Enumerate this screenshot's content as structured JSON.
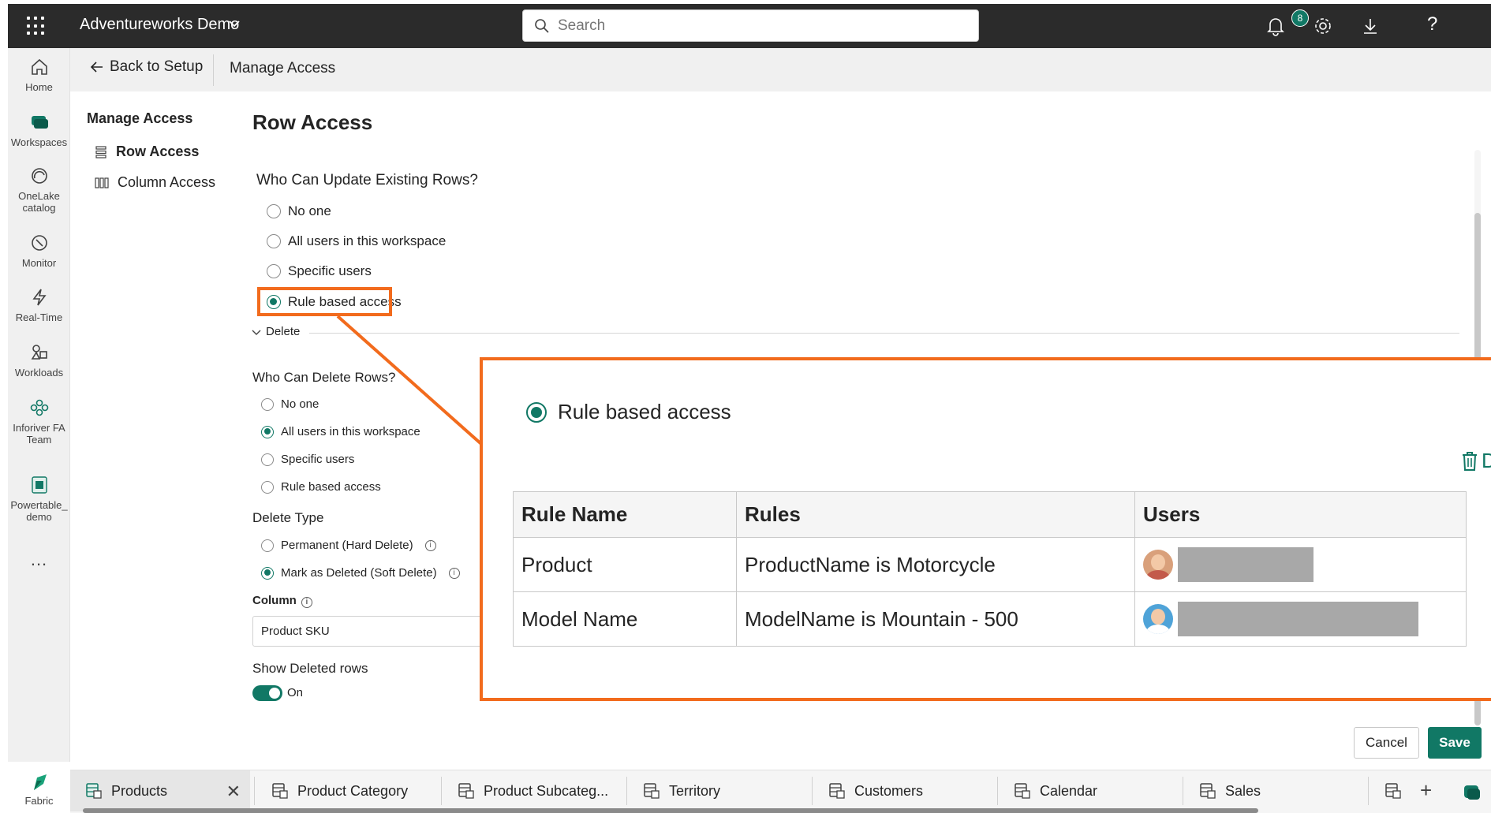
{
  "topbar": {
    "app_name": "Adventureworks Demo",
    "search_placeholder": "Search",
    "notification_count": "8",
    "help_label": "?"
  },
  "rail": {
    "items": [
      {
        "label": "Home",
        "icon": "home-icon"
      },
      {
        "label": "Workspaces",
        "icon": "workspaces-icon"
      },
      {
        "label": "OneLake catalog",
        "icon": "onelake-icon"
      },
      {
        "label": "Monitor",
        "icon": "monitor-icon"
      },
      {
        "label": "Real-Time",
        "icon": "real-time-icon"
      },
      {
        "label": "Workloads",
        "icon": "workloads-icon"
      },
      {
        "label": "Inforiver FA Team",
        "icon": "team-icon"
      },
      {
        "label": "Powertable_ demo",
        "icon": "powertable-icon"
      }
    ],
    "more": "...",
    "fabric_label": "Fabric"
  },
  "breadcrumb": {
    "back_label": "Back to Setup",
    "current": "Manage Access"
  },
  "subnav": {
    "title": "Manage Access",
    "items": [
      {
        "label": "Row Access",
        "active": true
      },
      {
        "label": "Column Access",
        "active": false
      }
    ]
  },
  "main": {
    "title": "Row Access",
    "update": {
      "question": "Who Can Update Existing Rows?",
      "options": [
        "No one",
        "All users in this workspace",
        "Specific users",
        "Rule based access"
      ],
      "selected": "Rule based access"
    },
    "delete_section_label": "Delete",
    "delete": {
      "question": "Who Can Delete Rows?",
      "options": [
        "No one",
        "All users in this workspace",
        "Specific users",
        "Rule based access"
      ],
      "selected": "All users in this workspace"
    },
    "delete_type": {
      "label": "Delete Type",
      "options": [
        "Permanent (Hard Delete)",
        "Mark as Deleted (Soft Delete)"
      ],
      "selected": "Mark as Deleted (Soft Delete)"
    },
    "column": {
      "label": "Column",
      "value": "Product SKU"
    },
    "show_deleted": {
      "label": "Show Deleted rows",
      "state": "On"
    }
  },
  "zoom": {
    "radio_label": "Rule based access",
    "trash_label": "D",
    "table": {
      "headers": [
        "Rule Name",
        "Rules",
        "Users"
      ],
      "rows": [
        {
          "name": "Product",
          "rule": "ProductName is Motorcycle"
        },
        {
          "name": "Model Name",
          "rule": "ModelName is Mountain - 500"
        }
      ]
    }
  },
  "actions": {
    "cancel": "Cancel",
    "save": "Save"
  },
  "tabs": [
    {
      "label": "Products",
      "active": true
    },
    {
      "label": "Product Category",
      "active": false
    },
    {
      "label": "Product Subcateg...",
      "active": false
    },
    {
      "label": "Territory",
      "active": false
    },
    {
      "label": "Customers",
      "active": false
    },
    {
      "label": "Calendar",
      "active": false
    },
    {
      "label": "Sales",
      "active": false
    }
  ],
  "colors": {
    "accent": "#117865",
    "highlight": "#f26b1d",
    "topbar": "#2b2b2b"
  }
}
